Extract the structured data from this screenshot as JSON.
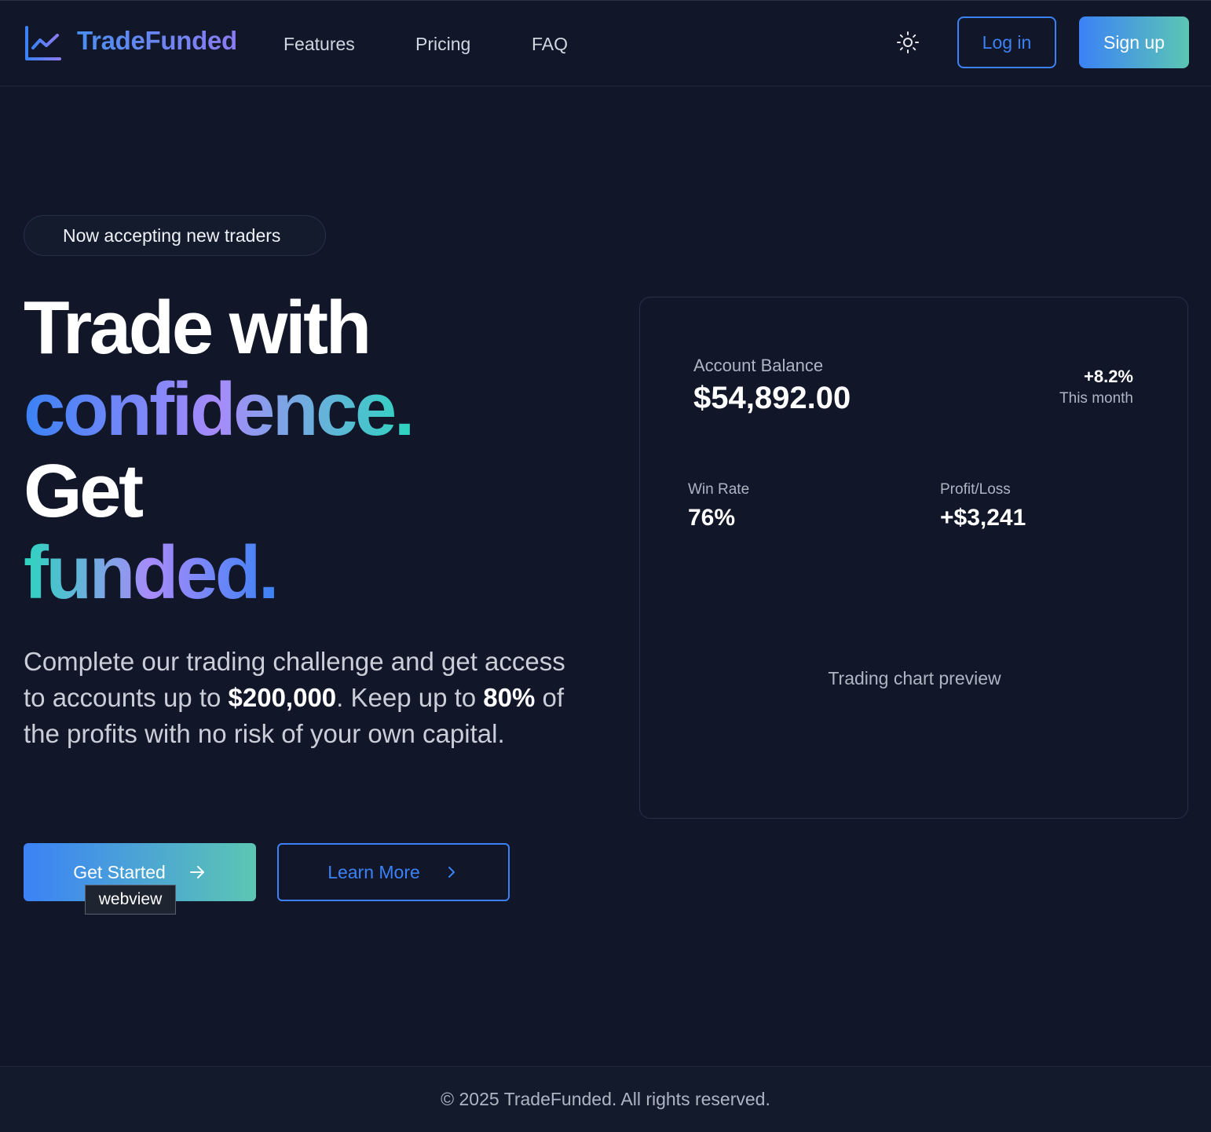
{
  "header": {
    "brand": "TradeFunded",
    "nav": {
      "features": "Features",
      "pricing": "Pricing",
      "faq": "FAQ"
    },
    "login_label": "Log in",
    "signup_label": "Sign up"
  },
  "hero": {
    "badge": "Now accepting new traders",
    "headline": {
      "line1": "Trade with",
      "line2": "confidence.",
      "line3": "Get",
      "line4": "funded."
    },
    "description": {
      "part1": "Complete our trading challenge and get access to accounts up to ",
      "amount": "$200,000",
      "part2": ". Keep up to ",
      "percent": "80%",
      "part3": " of the profits with no risk of your own capital."
    },
    "get_started_label": "Get Started",
    "learn_more_label": "Learn More",
    "tooltip": "webview"
  },
  "card": {
    "balance_label": "Account Balance",
    "balance_value": "$54,892.00",
    "change_value": "+8.2%",
    "change_label": "This month",
    "win_rate_label": "Win Rate",
    "win_rate_value": "76%",
    "pl_label": "Profit/Loss",
    "pl_value": "+$3,241",
    "chart_placeholder": "Trading chart preview"
  },
  "footer": {
    "copyright": "© 2025 TradeFunded. All rights reserved."
  },
  "colors": {
    "background": "#111729",
    "accent_blue": "#3b82f6",
    "accent_teal": "#5cc6b3",
    "accent_purple": "#a78bfa"
  },
  "icons": {
    "logo": "line-chart-icon",
    "theme": "sun-icon",
    "get_started": "arrow-right-icon",
    "learn_more": "chevron-right-icon"
  }
}
